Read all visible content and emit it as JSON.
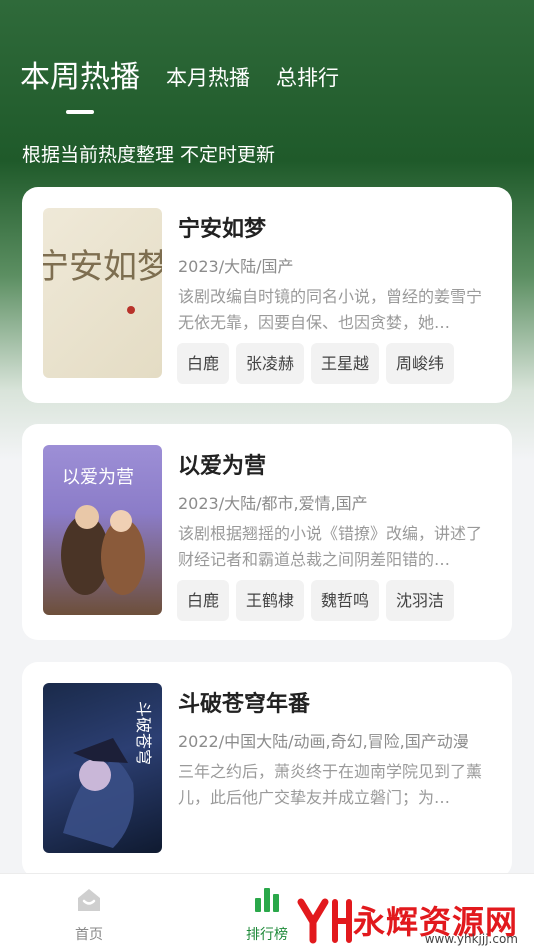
{
  "tabs": [
    {
      "label": "本周热播",
      "active": true
    },
    {
      "label": "本月热播",
      "active": false
    },
    {
      "label": "总排行",
      "active": false
    }
  ],
  "subtitle": "根据当前热度整理 不定时更新",
  "cards": [
    {
      "title": "宁安如梦",
      "meta": "2023/大陆/国产",
      "desc": "该剧改编自时镜的同名小说，曾经的姜雪宁无依无靠，因要自保、也因贪婪，她…",
      "poster_text": "宁安如梦",
      "tags": [
        "白鹿",
        "张凌赫",
        "王星越",
        "周峻纬"
      ]
    },
    {
      "title": "以爱为营",
      "meta": "2023/大陆/都市,爱情,国产",
      "desc": "该剧根据翘摇的小说《错撩》改编，讲述了财经记者和霸道总裁之间阴差阳错的…",
      "poster_text": "以爱为营",
      "tags": [
        "白鹿",
        "王鹤棣",
        "魏哲鸣",
        "沈羽洁"
      ]
    },
    {
      "title": "斗破苍穹年番",
      "meta": "2022/中国大陆/动画,奇幻,冒险,国产动漫",
      "desc": "三年之约后，萧炎终于在迦南学院见到了薰儿，此后他广交挚友并成立磐门；为…",
      "poster_text": "斗破苍穹",
      "tags": []
    }
  ],
  "nav": {
    "home": "首页",
    "ranking": "排行榜"
  },
  "watermark": {
    "text": "永辉资源网",
    "url": "www.yhkjjj.com"
  },
  "colors": {
    "accent": "#1f8a3a",
    "header_green": "#1f5a2a"
  }
}
